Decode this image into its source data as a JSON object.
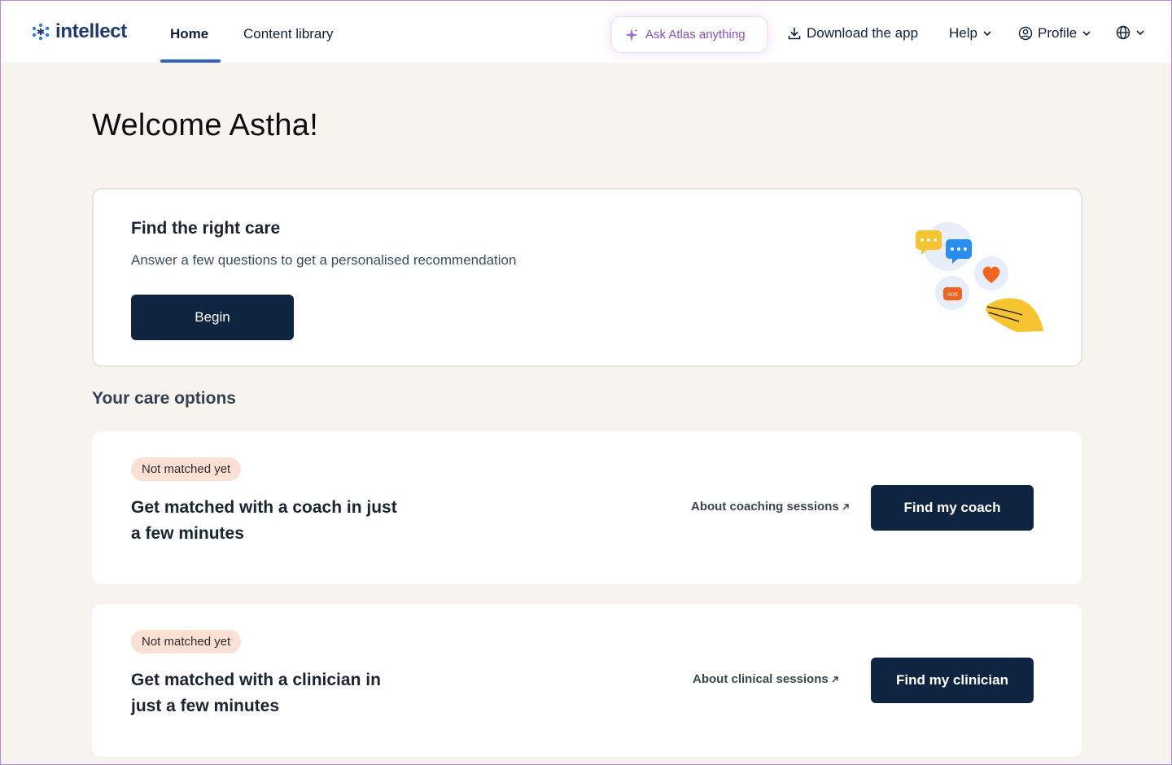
{
  "header": {
    "logo_text": "intellect",
    "nav": {
      "home": "Home",
      "content_library": "Content library"
    },
    "ask_atlas": "Ask Atlas anything",
    "download": "Download the app",
    "help": "Help",
    "profile": "Profile"
  },
  "main": {
    "welcome": "Welcome Astha!",
    "care_card": {
      "title": "Find the right care",
      "subtitle": "Answer a few questions to get a personalised recommendation",
      "button": "Begin",
      "illustration_sos": "SOS"
    },
    "options_title": "Your care options",
    "options": [
      {
        "badge": "Not matched yet",
        "title": "Get matched with a coach in just a few minutes",
        "link": "About coaching sessions",
        "button": "Find my coach"
      },
      {
        "badge": "Not matched yet",
        "title": "Get matched with a clinician in just a few minutes",
        "link": "About clinical sessions",
        "button": "Find my clinician"
      }
    ]
  },
  "colors": {
    "primary_button": "#0f2441",
    "accent_nav": "#2f66b6",
    "badge_bg": "#fde0d4",
    "page_bg": "#f7f4ef",
    "atlas_purple": "#8a4fc1"
  },
  "icons": [
    "intellect-logo-icon",
    "sparkle-icon",
    "download-icon",
    "chevron-down-icon",
    "user-circle-icon",
    "globe-icon",
    "arrow-up-right-icon"
  ]
}
